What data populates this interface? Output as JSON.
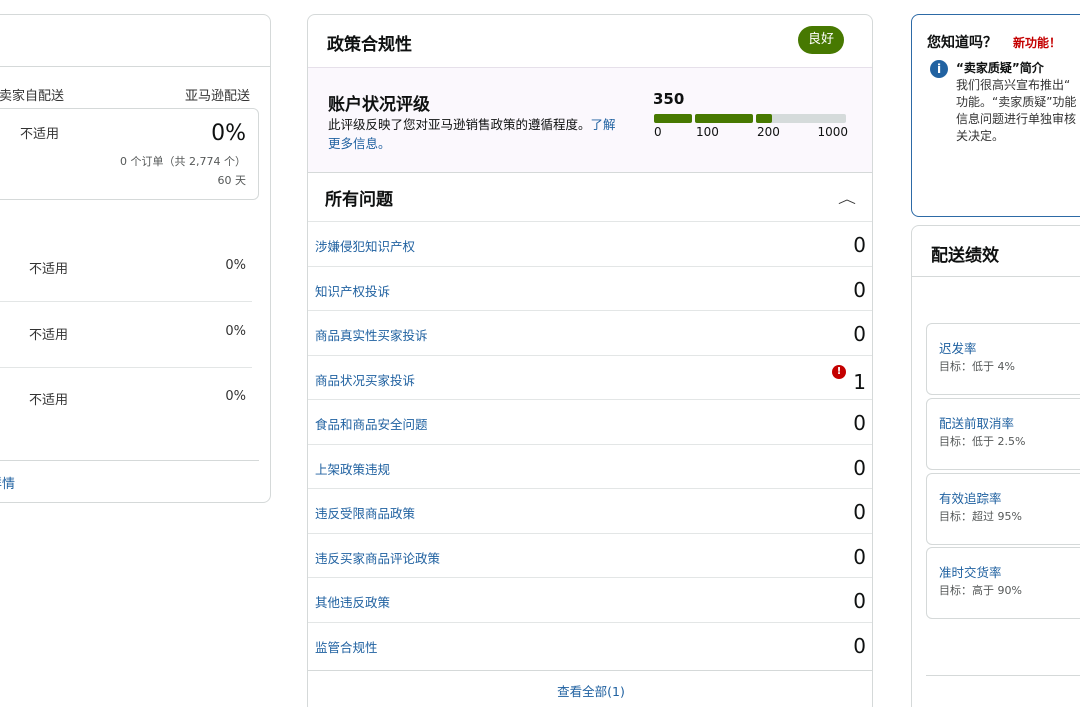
{
  "left_card": {
    "col_seller": "卖家自配送",
    "col_amazon": "亚马逊配送",
    "box": {
      "na": "不适用",
      "pct": "0%",
      "orders": "0 个订单（共 2,774 个）",
      "days": "60 天"
    },
    "rows": [
      {
        "na": "不适用",
        "pct": "0%"
      },
      {
        "na": "不适用",
        "pct": "0%"
      },
      {
        "na": "不适用",
        "pct": "0%"
      }
    ],
    "footer_link": "详情"
  },
  "policy": {
    "title": "政策合规性",
    "badge": "良好",
    "badge_color": "#477901",
    "rating_title": "账户状况评级",
    "rating_desc": "此评级反映了您对亚马逊销售政策的遵循程度。",
    "rating_link": "了解更多信息。",
    "score": "350",
    "score_value": 350,
    "gauge_ticks": [
      "0",
      "100",
      "200",
      "1000"
    ],
    "issues_title": "所有问题",
    "issues": [
      {
        "label": "涉嫌侵犯知识产权",
        "count": "0"
      },
      {
        "label": "知识产权投诉",
        "count": "0"
      },
      {
        "label": "商品真实性买家投诉",
        "count": "0"
      },
      {
        "label": "商品状况买家投诉",
        "count": "1",
        "alert": "!"
      },
      {
        "label": "食品和商品安全问题",
        "count": "0"
      },
      {
        "label": "上架政策违规",
        "count": "0"
      },
      {
        "label": "违反受限商品政策",
        "count": "0"
      },
      {
        "label": "违反买家商品评论政策",
        "count": "0"
      },
      {
        "label": "其他违反政策",
        "count": "0"
      },
      {
        "label": "监管合规性",
        "count": "0"
      }
    ],
    "view_all": "查看全部(1)"
  },
  "tip": {
    "title": "您知道吗？",
    "new_feature": "新功能！",
    "item_name": "“卖家质疑”简介",
    "item_lines": [
      "我们很高兴宣布推出“",
      "功能。“卖家质疑”功能",
      "信息问题进行单独审核",
      "关决定。"
    ]
  },
  "shipping": {
    "title": "配送绩效",
    "metrics": [
      {
        "name": "迟发率",
        "target": "目标：低于 4%"
      },
      {
        "name": "配送前取消率",
        "target": "目标：低于 2.5%"
      },
      {
        "name": "有效追踪率",
        "target": "目标：超过 95%"
      },
      {
        "name": "准时交货率",
        "target": "目标：高于 90%"
      }
    ]
  }
}
